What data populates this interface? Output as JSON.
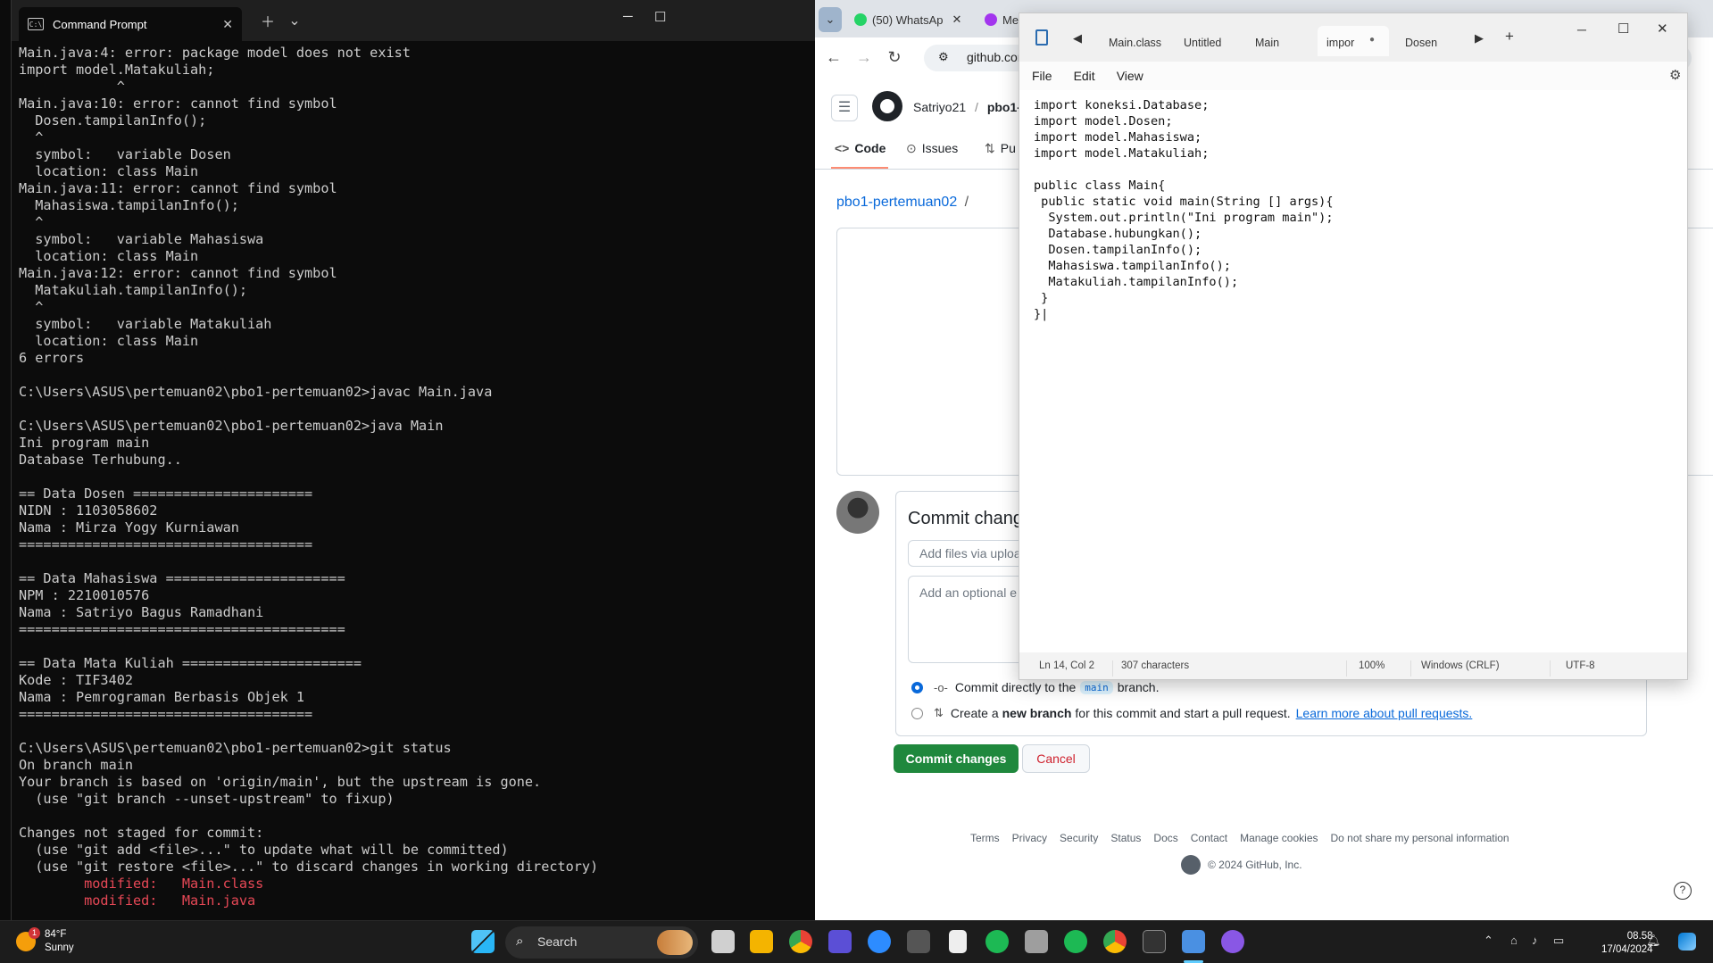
{
  "cmd": {
    "tab_title": "Command Prompt",
    "tab_icon_text": "C:\\",
    "lines": [
      {
        "t": "Main.java:4: error: package model does not exist"
      },
      {
        "t": "import model.Matakuliah;"
      },
      {
        "t": "            ^"
      },
      {
        "t": "Main.java:10: error: cannot find symbol"
      },
      {
        "t": "  Dosen.tampilanInfo();"
      },
      {
        "t": "  ^"
      },
      {
        "t": "  symbol:   variable Dosen"
      },
      {
        "t": "  location: class Main"
      },
      {
        "t": "Main.java:11: error: cannot find symbol"
      },
      {
        "t": "  Mahasiswa.tampilanInfo();"
      },
      {
        "t": "  ^"
      },
      {
        "t": "  symbol:   variable Mahasiswa"
      },
      {
        "t": "  location: class Main"
      },
      {
        "t": "Main.java:12: error: cannot find symbol"
      },
      {
        "t": "  Matakuliah.tampilanInfo();"
      },
      {
        "t": "  ^"
      },
      {
        "t": "  symbol:   variable Matakuliah"
      },
      {
        "t": "  location: class Main"
      },
      {
        "t": "6 errors"
      },
      {
        "t": ""
      },
      {
        "t": "C:\\Users\\ASUS\\pertemuan02\\pbo1-pertemuan02>javac Main.java"
      },
      {
        "t": ""
      },
      {
        "t": "C:\\Users\\ASUS\\pertemuan02\\pbo1-pertemuan02>java Main"
      },
      {
        "t": "Ini program main"
      },
      {
        "t": "Database Terhubung.."
      },
      {
        "t": ""
      },
      {
        "t": "== Data Dosen ======================"
      },
      {
        "t": "NIDN : 1103058602"
      },
      {
        "t": "Nama : Mirza Yogy Kurniawan"
      },
      {
        "t": "===================================="
      },
      {
        "t": ""
      },
      {
        "t": "== Data Mahasiswa ======================"
      },
      {
        "t": "NPM : 2210010576"
      },
      {
        "t": "Nama : Satriyo Bagus Ramadhani"
      },
      {
        "t": "========================================"
      },
      {
        "t": ""
      },
      {
        "t": "== Data Mata Kuliah ======================"
      },
      {
        "t": "Kode : TIF3402"
      },
      {
        "t": "Nama : Pemrograman Berbasis Objek 1"
      },
      {
        "t": "===================================="
      },
      {
        "t": ""
      },
      {
        "t": "C:\\Users\\ASUS\\pertemuan02\\pbo1-pertemuan02>git status"
      },
      {
        "t": "On branch main"
      },
      {
        "t": "Your branch is based on 'origin/main', but the upstream is gone."
      },
      {
        "t": "  (use \"git branch --unset-upstream\" to fixup)"
      },
      {
        "t": ""
      },
      {
        "t": "Changes not staged for commit:"
      },
      {
        "t": "  (use \"git add <file>...\" to update what will be committed)"
      },
      {
        "t": "  (use \"git restore <file>...\" to discard changes in working directory)"
      },
      {
        "t": "        modified:   Main.class",
        "red": true
      },
      {
        "t": "        modified:   Main.java",
        "red": true
      }
    ]
  },
  "browser": {
    "tab_whatsapp": "(50) WhatsAp",
    "tab_messenger": "Me",
    "url": "github.com",
    "owner": "Satriyo21",
    "repo_short": "pbo1-",
    "tab_code": "Code",
    "tab_issues": "Issues",
    "tab_pulls": "Pu",
    "breadcrumb": "pbo1-pertemuan02",
    "breadcrumb_sep": "/",
    "commit_title": "Commit chang",
    "add_files_placeholder": "Add files via uploa",
    "desc_placeholder": "Add an optional e",
    "radio_direct_pre": "Commit directly to the",
    "radio_direct_branch": "main",
    "radio_direct_post": "branch.",
    "radio_new_pre": "Create a",
    "radio_new_bold": "new branch",
    "radio_new_post": "for this commit and start a pull request.",
    "radio_new_link": "Learn more about pull requests.",
    "commit_button": "Commit changes",
    "cancel_button": "Cancel",
    "footer_links": [
      "Terms",
      "Privacy",
      "Security",
      "Status",
      "Docs",
      "Contact",
      "Manage cookies",
      "Do not share my personal information"
    ],
    "copyright": "© 2024 GitHub, Inc.",
    "help": "?"
  },
  "notepad": {
    "tabs": [
      "Main.class",
      "Untitled",
      "Main",
      "impor",
      "Dosen"
    ],
    "active_tab_index": 3,
    "menu": [
      "File",
      "Edit",
      "View"
    ],
    "code": "import koneksi.Database;\nimport model.Dosen;\nimport model.Mahasiswa;\nimport model.Matakuliah;\n\npublic class Main{\n public static void main(String [] args){\n  System.out.println(\"Ini program main\");\n  Database.hubungkan();\n  Dosen.tampilanInfo();\n  Mahasiswa.tampilanInfo();\n  Matakuliah.tampilanInfo();\n }\n}|",
    "status_position": "Ln 14, Col 2",
    "status_chars": "307 characters",
    "status_zoom": "100%",
    "status_eol": "Windows (CRLF)",
    "status_encoding": "UTF-8"
  },
  "taskbar": {
    "weather_temp": "84°F",
    "weather_desc": "Sunny",
    "weather_badge": "1",
    "search_label": "Search",
    "clock_time": "08.58",
    "clock_date": "17/04/2024"
  },
  "colors": {
    "cmd_bg": "#0c0c0c",
    "cmd_text": "#cccccc",
    "cmd_error": "#e74856",
    "github_green": "#1f883d",
    "github_link": "#0969da",
    "cancel_red": "#cf222e"
  }
}
